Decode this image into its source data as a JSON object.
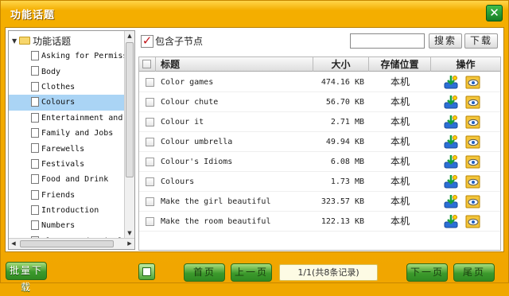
{
  "window": {
    "title": "功能话题",
    "close_label": "✕"
  },
  "tree": {
    "root_label": "功能话题",
    "items": [
      {
        "label": "Asking for Permission",
        "selected": false
      },
      {
        "label": "Body",
        "selected": false
      },
      {
        "label": "Clothes",
        "selected": false
      },
      {
        "label": "Colours",
        "selected": true
      },
      {
        "label": "Entertainment and",
        "selected": false
      },
      {
        "label": "Family and Jobs",
        "selected": false
      },
      {
        "label": "Farewells",
        "selected": false
      },
      {
        "label": "Festivals",
        "selected": false
      },
      {
        "label": "Food and Drink",
        "selected": false
      },
      {
        "label": "Friends",
        "selected": false
      },
      {
        "label": "Introduction",
        "selected": false
      },
      {
        "label": "Numbers",
        "selected": false
      },
      {
        "label": "Plants and Animals",
        "selected": false
      }
    ]
  },
  "toolbar": {
    "include_children_label": "包含子节点",
    "include_children_checked": true,
    "search_value": "",
    "search_label": "搜索",
    "download_label": "下载"
  },
  "table": {
    "headers": {
      "title": "标题",
      "size": "大小",
      "location": "存储位置",
      "action": "操作"
    },
    "rows": [
      {
        "title": "Color games",
        "size": "474.16 KB",
        "location": "本机"
      },
      {
        "title": "Colour chute",
        "size": "56.70 KB",
        "location": "本机"
      },
      {
        "title": "Colour it",
        "size": "2.71 MB",
        "location": "本机"
      },
      {
        "title": "Colour umbrella",
        "size": "49.94 KB",
        "location": "本机"
      },
      {
        "title": "Colour's Idioms",
        "size": "6.08 MB",
        "location": "本机"
      },
      {
        "title": "Colours",
        "size": "1.73 MB",
        "location": "本机"
      },
      {
        "title": "Make the girl beautiful",
        "size": "323.57 KB",
        "location": "本机"
      },
      {
        "title": "Make the room beautiful",
        "size": "122.13 KB",
        "location": "本机"
      }
    ]
  },
  "footer": {
    "batch_download": "批量下载",
    "first_page": "首页",
    "prev_page": "上一页",
    "page_info": "1/1(共8条记录)",
    "next_page": "下一页",
    "last_page": "尾页"
  },
  "icons": {
    "close": "close-icon",
    "folder": "folder-icon",
    "document": "document-icon",
    "download": "download-icon",
    "view": "eye-icon",
    "image": "image-icon"
  }
}
